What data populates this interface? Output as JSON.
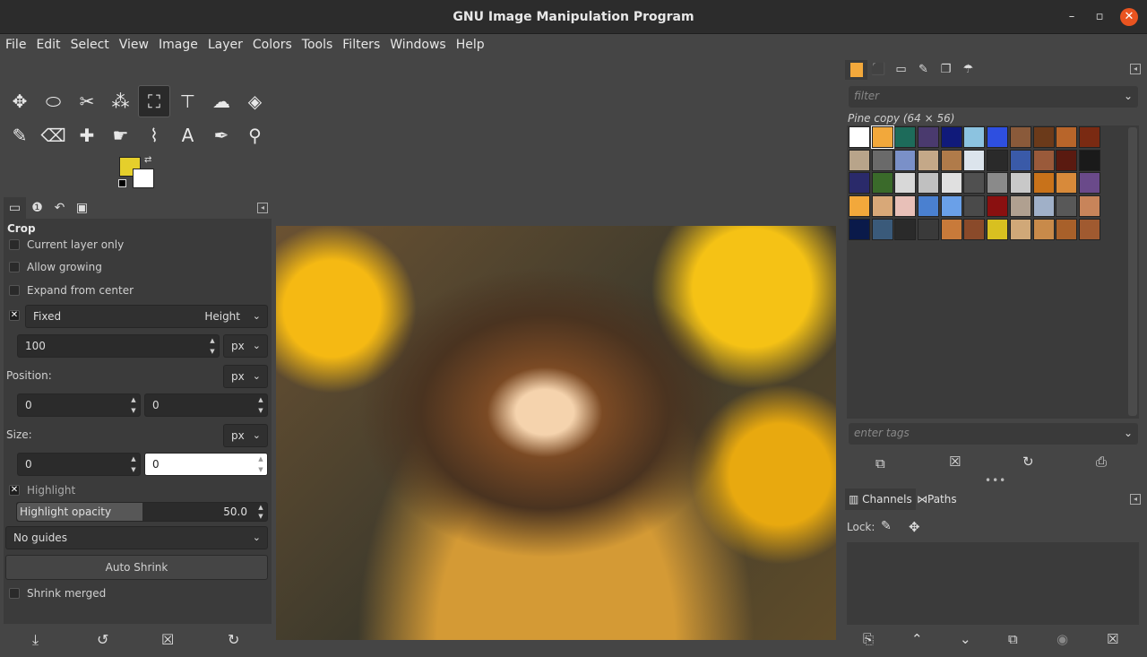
{
  "window": {
    "title": "GNU Image Manipulation Program",
    "min": "–",
    "max": "▫",
    "close": "✕"
  },
  "menu": [
    "File",
    "Edit",
    "Select",
    "View",
    "Image",
    "Layer",
    "Colors",
    "Tools",
    "Filters",
    "Windows",
    "Help"
  ],
  "tools": [
    {
      "name": "move-tool-icon",
      "glyph": "✥"
    },
    {
      "name": "ellipse-select-icon",
      "glyph": "⬭"
    },
    {
      "name": "scissors-icon",
      "glyph": "✂"
    },
    {
      "name": "fuzzy-select-icon",
      "glyph": "⁂"
    },
    {
      "name": "crop-tool-icon",
      "glyph": "⛶",
      "active": true
    },
    {
      "name": "unified-transform-icon",
      "glyph": "⊤"
    },
    {
      "name": "warp-transform-icon",
      "glyph": "☁"
    },
    {
      "name": "bucket-fill-icon",
      "glyph": "◈"
    },
    {
      "name": "paintbrush-icon",
      "glyph": "✎"
    },
    {
      "name": "eraser-icon",
      "glyph": "⌫"
    },
    {
      "name": "heal-icon",
      "glyph": "✚"
    },
    {
      "name": "smudge-icon",
      "glyph": "☛"
    },
    {
      "name": "paths-tool-icon",
      "glyph": "⌇"
    },
    {
      "name": "text-tool-icon",
      "glyph": "A"
    },
    {
      "name": "color-picker-icon",
      "glyph": "✒"
    },
    {
      "name": "zoom-icon",
      "glyph": "⚲"
    }
  ],
  "colors": {
    "foreground": "#e5cf2b",
    "background": "#ffffff"
  },
  "tool_options": {
    "title": "Crop",
    "current_layer_only": "Current layer only",
    "allow_growing": "Allow growing",
    "expand_from_center": "Expand from center",
    "fixed": "Fixed",
    "fixed_mode": "Height",
    "fixed_value": "100",
    "unit": "px",
    "position_label": "Position:",
    "position_x": "0",
    "position_y": "0",
    "size_label": "Size:",
    "size_w": "0",
    "size_h": "0",
    "highlight": "Highlight",
    "highlight_opacity_label": "Highlight opacity",
    "highlight_opacity": "50.0",
    "highlight_opacity_fraction": 0.5,
    "guides": "No guides",
    "auto_shrink": "Auto Shrink",
    "shrink_merged": "Shrink merged"
  },
  "patterns": {
    "filter_placeholder": "filter",
    "current": "Pine copy (64 × 56)",
    "tags_placeholder": "enter tags",
    "swatches": [
      "#ffffff",
      "#f2a83b",
      "#1d6b5a",
      "#4a3a6e",
      "#101a7a",
      "#8cc3e0",
      "#2e4fe0",
      "#8a5a3a",
      "#6b3a1a",
      "#b8652a",
      "#7a2a12",
      "#b8a48a",
      "#6a6a6a",
      "#7a90c8",
      "#c4a888",
      "#b07b4a",
      "#dce4ec",
      "#2a2a2a",
      "#3a5aa8",
      "#9a5a3a",
      "#5a1a10",
      "#1a1a1a",
      "#2a2a6a",
      "#3a6a2a",
      "#d8d8d8",
      "#c0c0c0",
      "#e0e0e0",
      "#505050",
      "#8a8a8a",
      "#c8c8c8",
      "#c8721a",
      "#d88a3a",
      "#6a4a8a",
      "#f2a83b",
      "#d8a878",
      "#e8c0b8",
      "#4a80d0",
      "#6aa0e8",
      "#4a4a4a",
      "#8a1010",
      "#b0a090",
      "#a0b0c8",
      "#585858",
      "#c8845a",
      "#0a1a4a",
      "#3a5a7a",
      "#2a2a2a",
      "#3a3a3a",
      "#c87a3a",
      "#8a4a2a",
      "#d8c020",
      "#d0a878",
      "#c88a4a",
      "#a8602a",
      "#a05a30"
    ]
  },
  "channels": {
    "tab1": "Channels",
    "tab2": "Paths",
    "lock_label": "Lock:"
  }
}
